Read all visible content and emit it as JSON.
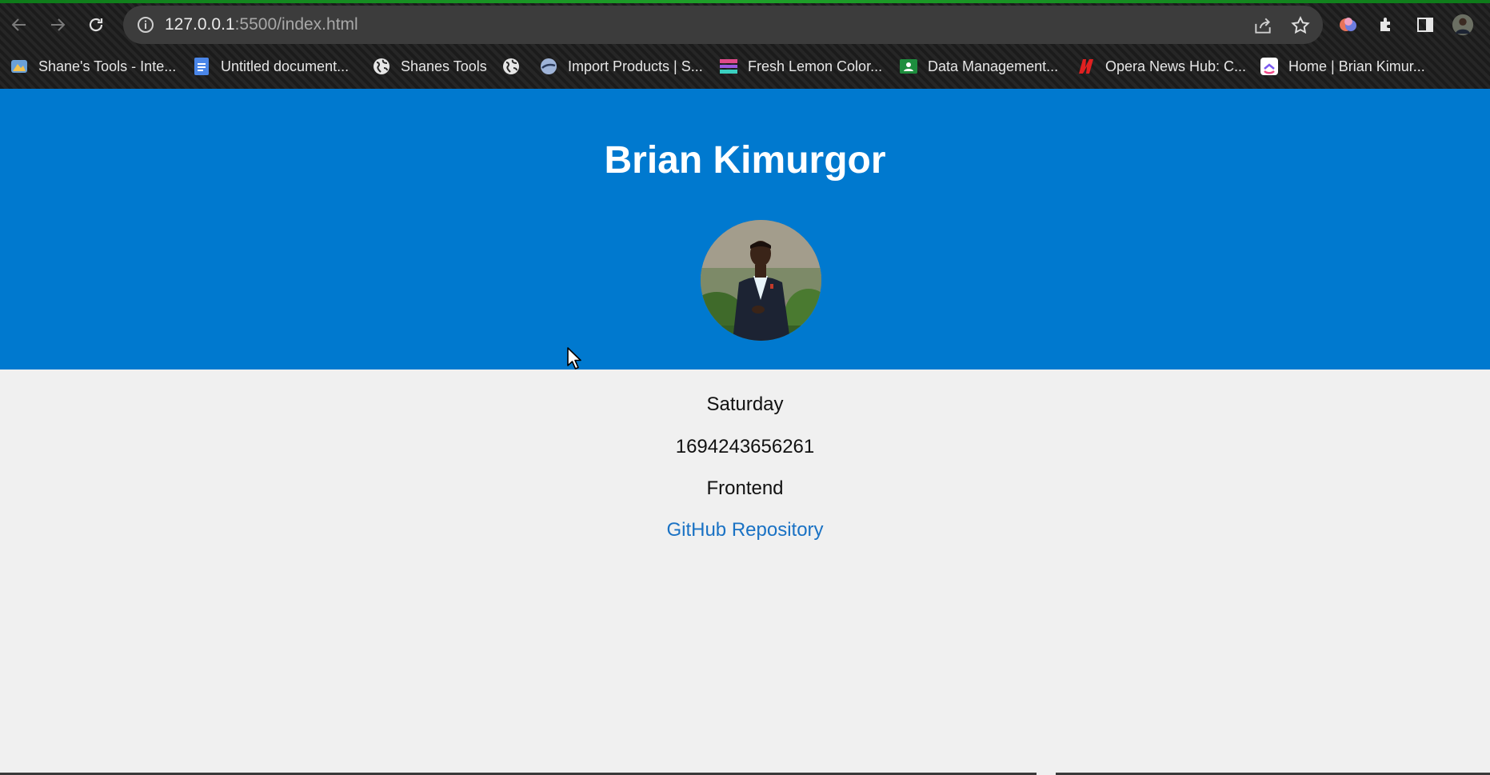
{
  "browser": {
    "url_host": "127.0.0.1",
    "url_rest": ":5500/index.html",
    "bookmarks": [
      {
        "label": "Shane's Tools - Inte...",
        "icon": "shanes-tools-favicon"
      },
      {
        "label": "Untitled document...",
        "icon": "google-docs-favicon"
      },
      {
        "label": "Shanes Tools",
        "icon": "globe-favicon"
      },
      {
        "label": "",
        "icon": "globe-favicon"
      },
      {
        "label": "Import Products | S...",
        "icon": "import-products-favicon"
      },
      {
        "label": "Fresh Lemon Color...",
        "icon": "fresh-lemon-favicon"
      },
      {
        "label": "Data Management...",
        "icon": "google-classroom-favicon"
      },
      {
        "label": "Opera News Hub: C...",
        "icon": "opera-news-favicon"
      },
      {
        "label": "Home | Brian Kimur...",
        "icon": "clickup-favicon"
      }
    ]
  },
  "page": {
    "title": "Brian Kimurgor",
    "avatar_alt": "profile photo",
    "day": "Saturday",
    "timestamp": "1694243656261",
    "track": "Frontend",
    "github_link": "GitHub Repository"
  },
  "colors": {
    "header_bg": "#0079cf",
    "page_bg": "#f0f0f0",
    "link": "#1a72c4"
  }
}
